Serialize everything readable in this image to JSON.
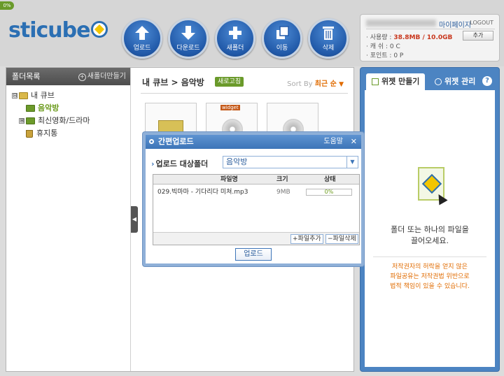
{
  "badge": "0%",
  "logo": {
    "text_a": "sticube",
    "icon": "cube-logo-icon"
  },
  "toolbar": [
    {
      "label": "업로드",
      "icon": "upload-arrow-icon"
    },
    {
      "label": "다운로드",
      "icon": "download-arrow-icon"
    },
    {
      "label": "새폴더",
      "icon": "plus-icon"
    },
    {
      "label": "이동",
      "icon": "move-icon"
    },
    {
      "label": "삭제",
      "icon": "trash-icon"
    }
  ],
  "user": {
    "mypage": "마이페이지",
    "logout": "LOGOUT",
    "usage_label": "· 사용량 :",
    "usage_value": "38.8MB / 10.0GB",
    "add": "추가",
    "cash_label": "· 캐   쉬 :",
    "cash_value": "0 C",
    "point_label": "· 포인트 :",
    "point_value": "0 P"
  },
  "sidebar": {
    "header": "폴더목록",
    "new_folder": "새폴더만들기",
    "tree": [
      {
        "label": "내 큐브",
        "box": "⊟"
      },
      {
        "label": "음악방"
      },
      {
        "label": "최신영화/드라마",
        "box": "⊞"
      },
      {
        "label": "휴지통"
      }
    ]
  },
  "content": {
    "breadcrumb": "내 큐브 > 음악방",
    "refresh": "새로고침",
    "sort_label": "Sort By",
    "sort_value": "최근 순",
    "widget_label": "widget"
  },
  "right": {
    "tab_make": "위젯 만들기",
    "tab_manage": "위젯 관리",
    "help": "?",
    "drop_line1": "폴더 또는 하나의 파일을",
    "drop_line2": "끌어오세요.",
    "warn_line1": "저작권자의 허락을 얻지 않은",
    "warn_line2": "파일공유는 저작권법 위반으로",
    "warn_line3": "법적 책임이 있을 수 있습니다."
  },
  "dialog": {
    "title": "간편업로드",
    "help": "도움말",
    "close": "✕",
    "target_label": "업로드 대상폴더",
    "target_value": "음악방",
    "col_name": "파일명",
    "col_size": "크기",
    "col_status": "상태",
    "file_name": "029.빅마마 - 기다리다 미쳐.mp3",
    "file_size": "9MB",
    "file_progress": "0%",
    "add_file": "+파일추가",
    "del_file": "−파일삭제",
    "upload": "업로드"
  },
  "colors": {
    "accent_blue": "#2b6fb3",
    "accent_green": "#6a9a2a",
    "accent_red": "#c8361c"
  }
}
